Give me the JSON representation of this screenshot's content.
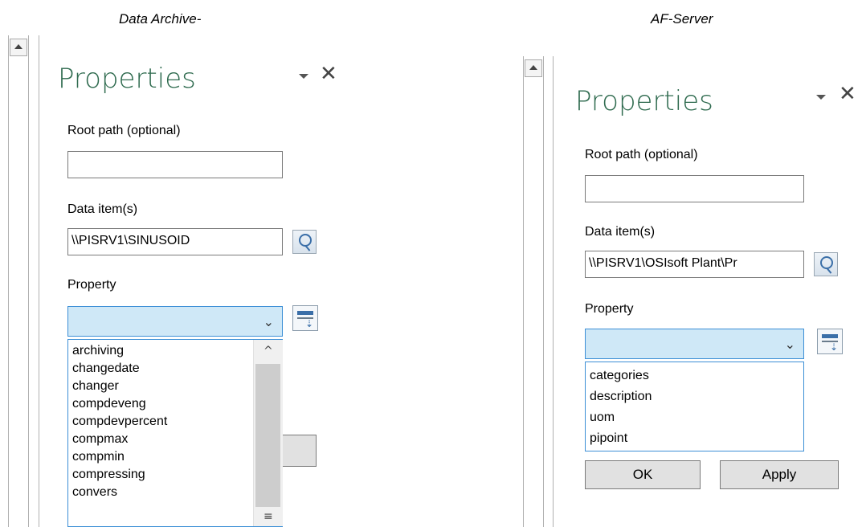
{
  "captions": {
    "left": "Data Archive-",
    "right": "AF-Server"
  },
  "left_pane": {
    "title": "Properties",
    "root_path_label": "Root path (optional)",
    "root_path_value": "",
    "data_items_label": "Data item(s)",
    "data_items_value": "\\\\PISRV1\\SINUSOID",
    "property_label": "Property",
    "property_selected": "",
    "dropdown_items": [
      "archiving",
      "changedate",
      "changer",
      "compdeveng",
      "compdevpercent",
      "compmax",
      "compmin",
      "compressing",
      "convers"
    ]
  },
  "right_pane": {
    "title": "Properties",
    "root_path_label": "Root path (optional)",
    "root_path_value": "",
    "data_items_label": "Data item(s)",
    "data_items_value": "\\\\PISRV1\\OSIsoft Plant\\Pr",
    "property_label": "Property",
    "property_selected": "",
    "dropdown_items": [
      "categories",
      "description",
      "uom",
      "pipoint"
    ],
    "ok_label": "OK",
    "apply_label": "Apply"
  },
  "icons": {
    "close": "close-icon",
    "pin": "dropdown-pin-icon",
    "browse": "search-icon",
    "add": "add-to-list-icon",
    "scroll_up": "scroll-up-icon",
    "chevron": "chevron-down-icon"
  },
  "colors": {
    "title": "#2f6b4f",
    "combo_fill": "#cfe8f7",
    "combo_border": "#3c8fd6"
  }
}
